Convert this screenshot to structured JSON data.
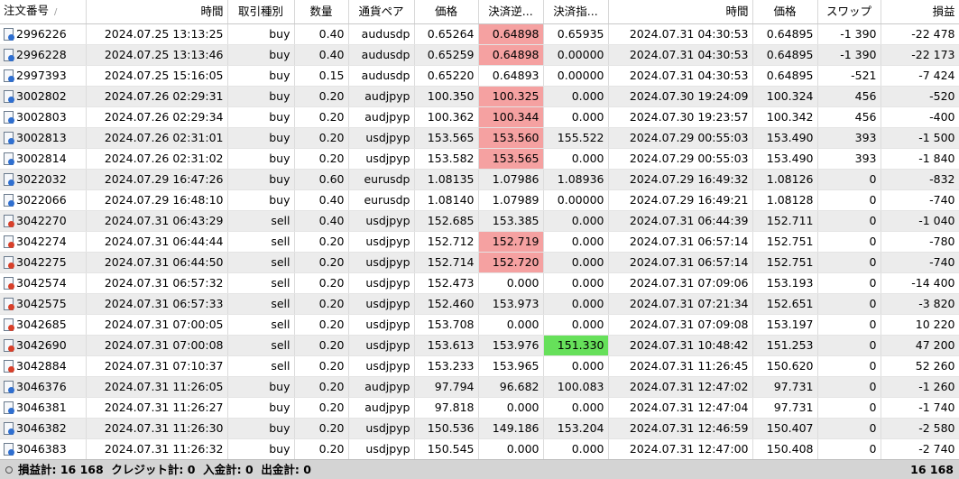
{
  "headers": {
    "order": "注文番号",
    "sort_indicator": "/",
    "open_time": "時間",
    "type": "取引種別",
    "volume": "数量",
    "symbol": "通貨ペア",
    "open_price": "価格",
    "sl": "決済逆...",
    "tp": "決済指...",
    "close_time": "時間",
    "close_price": "価格",
    "swap": "スワップ",
    "profit": "損益"
  },
  "rows": [
    {
      "order": "2996226",
      "open_time": "2024.07.25 13:13:25",
      "type": "buy",
      "volume": "0.40",
      "symbol": "audusdp",
      "open_price": "0.65264",
      "sl": "0.64898",
      "tp": "0.65935",
      "close_time": "2024.07.31 04:30:53",
      "close_price": "0.64895",
      "swap": "-1 390",
      "profit": "-22 478",
      "hl": "sl"
    },
    {
      "order": "2996228",
      "open_time": "2024.07.25 13:13:46",
      "type": "buy",
      "volume": "0.40",
      "symbol": "audusdp",
      "open_price": "0.65259",
      "sl": "0.64898",
      "tp": "0.00000",
      "close_time": "2024.07.31 04:30:53",
      "close_price": "0.64895",
      "swap": "-1 390",
      "profit": "-22 173",
      "hl": "sl"
    },
    {
      "order": "2997393",
      "open_time": "2024.07.25 15:16:05",
      "type": "buy",
      "volume": "0.15",
      "symbol": "audusdp",
      "open_price": "0.65220",
      "sl": "0.64893",
      "tp": "0.00000",
      "close_time": "2024.07.31 04:30:53",
      "close_price": "0.64895",
      "swap": "-521",
      "profit": "-7 424",
      "hl": ""
    },
    {
      "order": "3002802",
      "open_time": "2024.07.26 02:29:31",
      "type": "buy",
      "volume": "0.20",
      "symbol": "audjpyp",
      "open_price": "100.350",
      "sl": "100.325",
      "tp": "0.000",
      "close_time": "2024.07.30 19:24:09",
      "close_price": "100.324",
      "swap": "456",
      "profit": "-520",
      "hl": "sl"
    },
    {
      "order": "3002803",
      "open_time": "2024.07.26 02:29:34",
      "type": "buy",
      "volume": "0.20",
      "symbol": "audjpyp",
      "open_price": "100.362",
      "sl": "100.344",
      "tp": "0.000",
      "close_time": "2024.07.30 19:23:57",
      "close_price": "100.342",
      "swap": "456",
      "profit": "-400",
      "hl": "sl"
    },
    {
      "order": "3002813",
      "open_time": "2024.07.26 02:31:01",
      "type": "buy",
      "volume": "0.20",
      "symbol": "usdjpyp",
      "open_price": "153.565",
      "sl": "153.560",
      "tp": "155.522",
      "close_time": "2024.07.29 00:55:03",
      "close_price": "153.490",
      "swap": "393",
      "profit": "-1 500",
      "hl": "sl"
    },
    {
      "order": "3002814",
      "open_time": "2024.07.26 02:31:02",
      "type": "buy",
      "volume": "0.20",
      "symbol": "usdjpyp",
      "open_price": "153.582",
      "sl": "153.565",
      "tp": "0.000",
      "close_time": "2024.07.29 00:55:03",
      "close_price": "153.490",
      "swap": "393",
      "profit": "-1 840",
      "hl": "sl"
    },
    {
      "order": "3022032",
      "open_time": "2024.07.29 16:47:26",
      "type": "buy",
      "volume": "0.60",
      "symbol": "eurusdp",
      "open_price": "1.08135",
      "sl": "1.07986",
      "tp": "1.08936",
      "close_time": "2024.07.29 16:49:32",
      "close_price": "1.08126",
      "swap": "0",
      "profit": "-832",
      "hl": ""
    },
    {
      "order": "3022066",
      "open_time": "2024.07.29 16:48:10",
      "type": "buy",
      "volume": "0.40",
      "symbol": "eurusdp",
      "open_price": "1.08140",
      "sl": "1.07989",
      "tp": "0.00000",
      "close_time": "2024.07.29 16:49:21",
      "close_price": "1.08128",
      "swap": "0",
      "profit": "-740",
      "hl": ""
    },
    {
      "order": "3042270",
      "open_time": "2024.07.31 06:43:29",
      "type": "sell",
      "volume": "0.40",
      "symbol": "usdjpyp",
      "open_price": "152.685",
      "sl": "153.385",
      "tp": "0.000",
      "close_time": "2024.07.31 06:44:39",
      "close_price": "152.711",
      "swap": "0",
      "profit": "-1 040",
      "hl": ""
    },
    {
      "order": "3042274",
      "open_time": "2024.07.31 06:44:44",
      "type": "sell",
      "volume": "0.20",
      "symbol": "usdjpyp",
      "open_price": "152.712",
      "sl": "152.719",
      "tp": "0.000",
      "close_time": "2024.07.31 06:57:14",
      "close_price": "152.751",
      "swap": "0",
      "profit": "-780",
      "hl": "sl"
    },
    {
      "order": "3042275",
      "open_time": "2024.07.31 06:44:50",
      "type": "sell",
      "volume": "0.20",
      "symbol": "usdjpyp",
      "open_price": "152.714",
      "sl": "152.720",
      "tp": "0.000",
      "close_time": "2024.07.31 06:57:14",
      "close_price": "152.751",
      "swap": "0",
      "profit": "-740",
      "hl": "sl"
    },
    {
      "order": "3042574",
      "open_time": "2024.07.31 06:57:32",
      "type": "sell",
      "volume": "0.20",
      "symbol": "usdjpyp",
      "open_price": "152.473",
      "sl": "0.000",
      "tp": "0.000",
      "close_time": "2024.07.31 07:09:06",
      "close_price": "153.193",
      "swap": "0",
      "profit": "-14 400",
      "hl": ""
    },
    {
      "order": "3042575",
      "open_time": "2024.07.31 06:57:33",
      "type": "sell",
      "volume": "0.20",
      "symbol": "usdjpyp",
      "open_price": "152.460",
      "sl": "153.973",
      "tp": "0.000",
      "close_time": "2024.07.31 07:21:34",
      "close_price": "152.651",
      "swap": "0",
      "profit": "-3 820",
      "hl": ""
    },
    {
      "order": "3042685",
      "open_time": "2024.07.31 07:00:05",
      "type": "sell",
      "volume": "0.20",
      "symbol": "usdjpyp",
      "open_price": "153.708",
      "sl": "0.000",
      "tp": "0.000",
      "close_time": "2024.07.31 07:09:08",
      "close_price": "153.197",
      "swap": "0",
      "profit": "10 220",
      "hl": ""
    },
    {
      "order": "3042690",
      "open_time": "2024.07.31 07:00:08",
      "type": "sell",
      "volume": "0.20",
      "symbol": "usdjpyp",
      "open_price": "153.613",
      "sl": "153.976",
      "tp": "151.330",
      "close_time": "2024.07.31 10:48:42",
      "close_price": "151.253",
      "swap": "0",
      "profit": "47 200",
      "hl": "tp"
    },
    {
      "order": "3042884",
      "open_time": "2024.07.31 07:10:37",
      "type": "sell",
      "volume": "0.20",
      "symbol": "usdjpyp",
      "open_price": "153.233",
      "sl": "153.965",
      "tp": "0.000",
      "close_time": "2024.07.31 11:26:45",
      "close_price": "150.620",
      "swap": "0",
      "profit": "52 260",
      "hl": ""
    },
    {
      "order": "3046376",
      "open_time": "2024.07.31 11:26:05",
      "type": "buy",
      "volume": "0.20",
      "symbol": "audjpyp",
      "open_price": "97.794",
      "sl": "96.682",
      "tp": "100.083",
      "close_time": "2024.07.31 12:47:02",
      "close_price": "97.731",
      "swap": "0",
      "profit": "-1 260",
      "hl": ""
    },
    {
      "order": "3046381",
      "open_time": "2024.07.31 11:26:27",
      "type": "buy",
      "volume": "0.20",
      "symbol": "audjpyp",
      "open_price": "97.818",
      "sl": "0.000",
      "tp": "0.000",
      "close_time": "2024.07.31 12:47:04",
      "close_price": "97.731",
      "swap": "0",
      "profit": "-1 740",
      "hl": ""
    },
    {
      "order": "3046382",
      "open_time": "2024.07.31 11:26:30",
      "type": "buy",
      "volume": "0.20",
      "symbol": "usdjpyp",
      "open_price": "150.536",
      "sl": "149.186",
      "tp": "153.204",
      "close_time": "2024.07.31 12:46:59",
      "close_price": "150.407",
      "swap": "0",
      "profit": "-2 580",
      "hl": ""
    },
    {
      "order": "3046383",
      "open_time": "2024.07.31 11:26:32",
      "type": "buy",
      "volume": "0.20",
      "symbol": "usdjpyp",
      "open_price": "150.545",
      "sl": "0.000",
      "tp": "0.000",
      "close_time": "2024.07.31 12:47:00",
      "close_price": "150.408",
      "swap": "0",
      "profit": "-2 740",
      "hl": ""
    }
  ],
  "status": {
    "summary": "損益計: 16 168  クレジット計: 0  入金計: 0  出金計: 0",
    "total": "16 168"
  },
  "colors": {
    "sl_highlight": "#f5a1a1",
    "tp_highlight": "#66e05a",
    "buy_icon": "#2f6fd0",
    "sell_icon": "#d8402a"
  }
}
